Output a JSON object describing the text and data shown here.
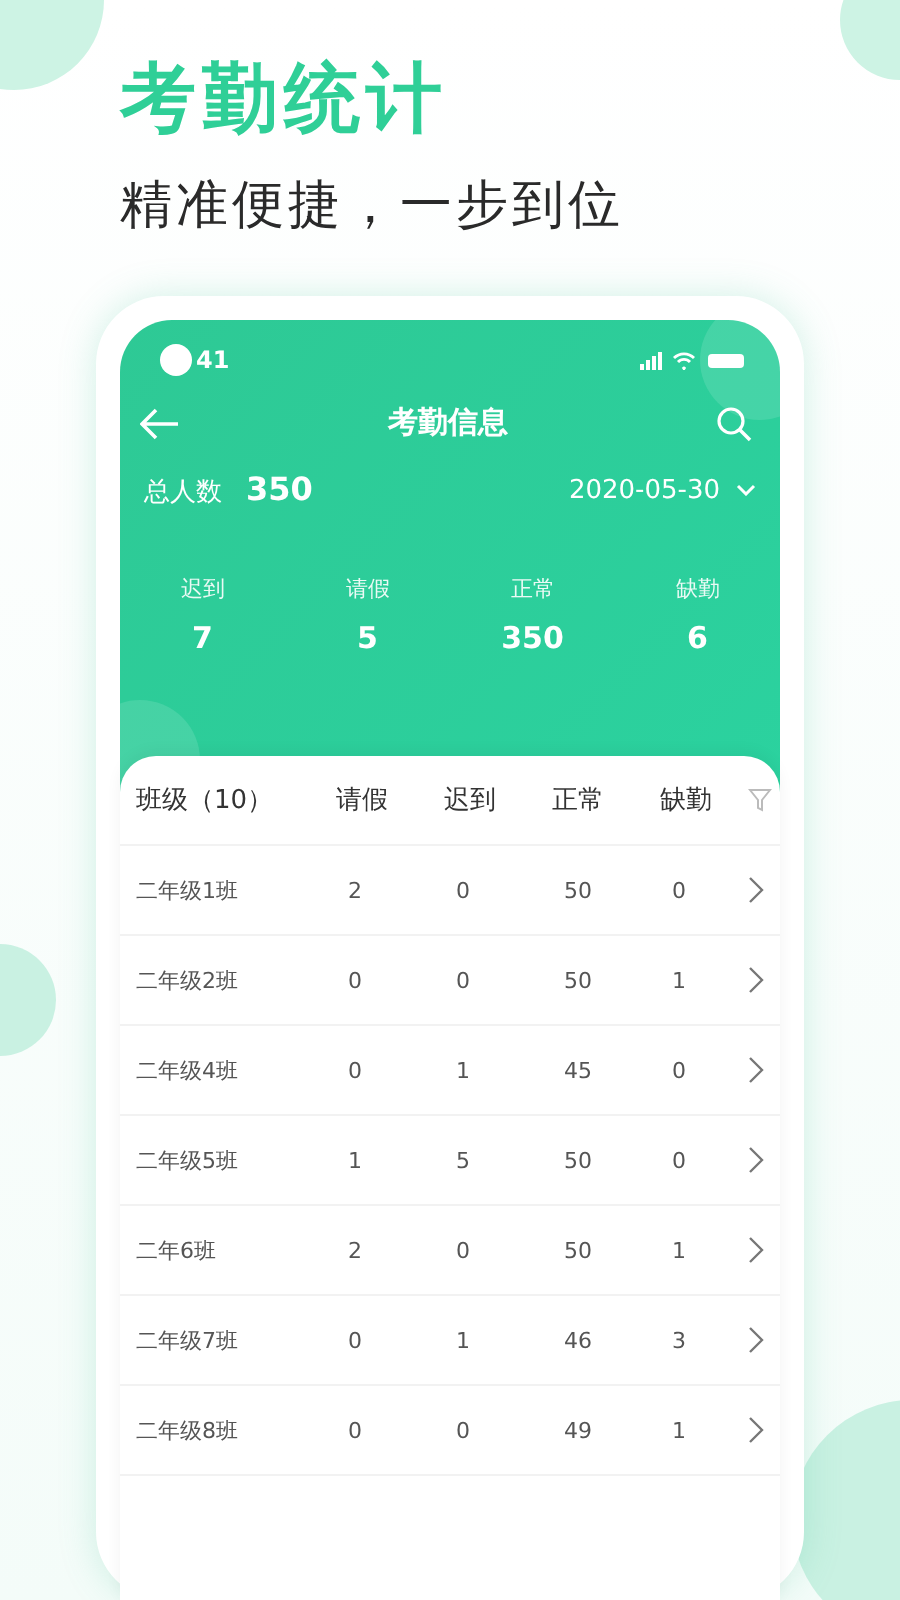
{
  "headline": {
    "title": "考勤统计",
    "subtitle": "精准便捷，一步到位"
  },
  "status_bar": {
    "time": "41"
  },
  "nav": {
    "title": "考勤信息"
  },
  "summary": {
    "total_label": "总人数",
    "total_value": "350",
    "date": "2020-05-30"
  },
  "stats": [
    {
      "label": "迟到",
      "value": "7"
    },
    {
      "label": "请假",
      "value": "5"
    },
    {
      "label": "正常",
      "value": "350"
    },
    {
      "label": "缺勤",
      "value": "6"
    }
  ],
  "table": {
    "columns": [
      "班级（10）",
      "请假",
      "迟到",
      "正常",
      "缺勤"
    ],
    "rows": [
      [
        "二年级1班",
        "2",
        "0",
        "50",
        "0"
      ],
      [
        "二年级2班",
        "0",
        "0",
        "50",
        "1"
      ],
      [
        "二年级4班",
        "0",
        "1",
        "45",
        "0"
      ],
      [
        "二年级5班",
        "1",
        "5",
        "50",
        "0"
      ],
      [
        "二年6班",
        "2",
        "0",
        "50",
        "1"
      ],
      [
        "二年级7班",
        "0",
        "1",
        "46",
        "3"
      ],
      [
        "二年级8班",
        "0",
        "0",
        "49",
        "1"
      ]
    ]
  }
}
